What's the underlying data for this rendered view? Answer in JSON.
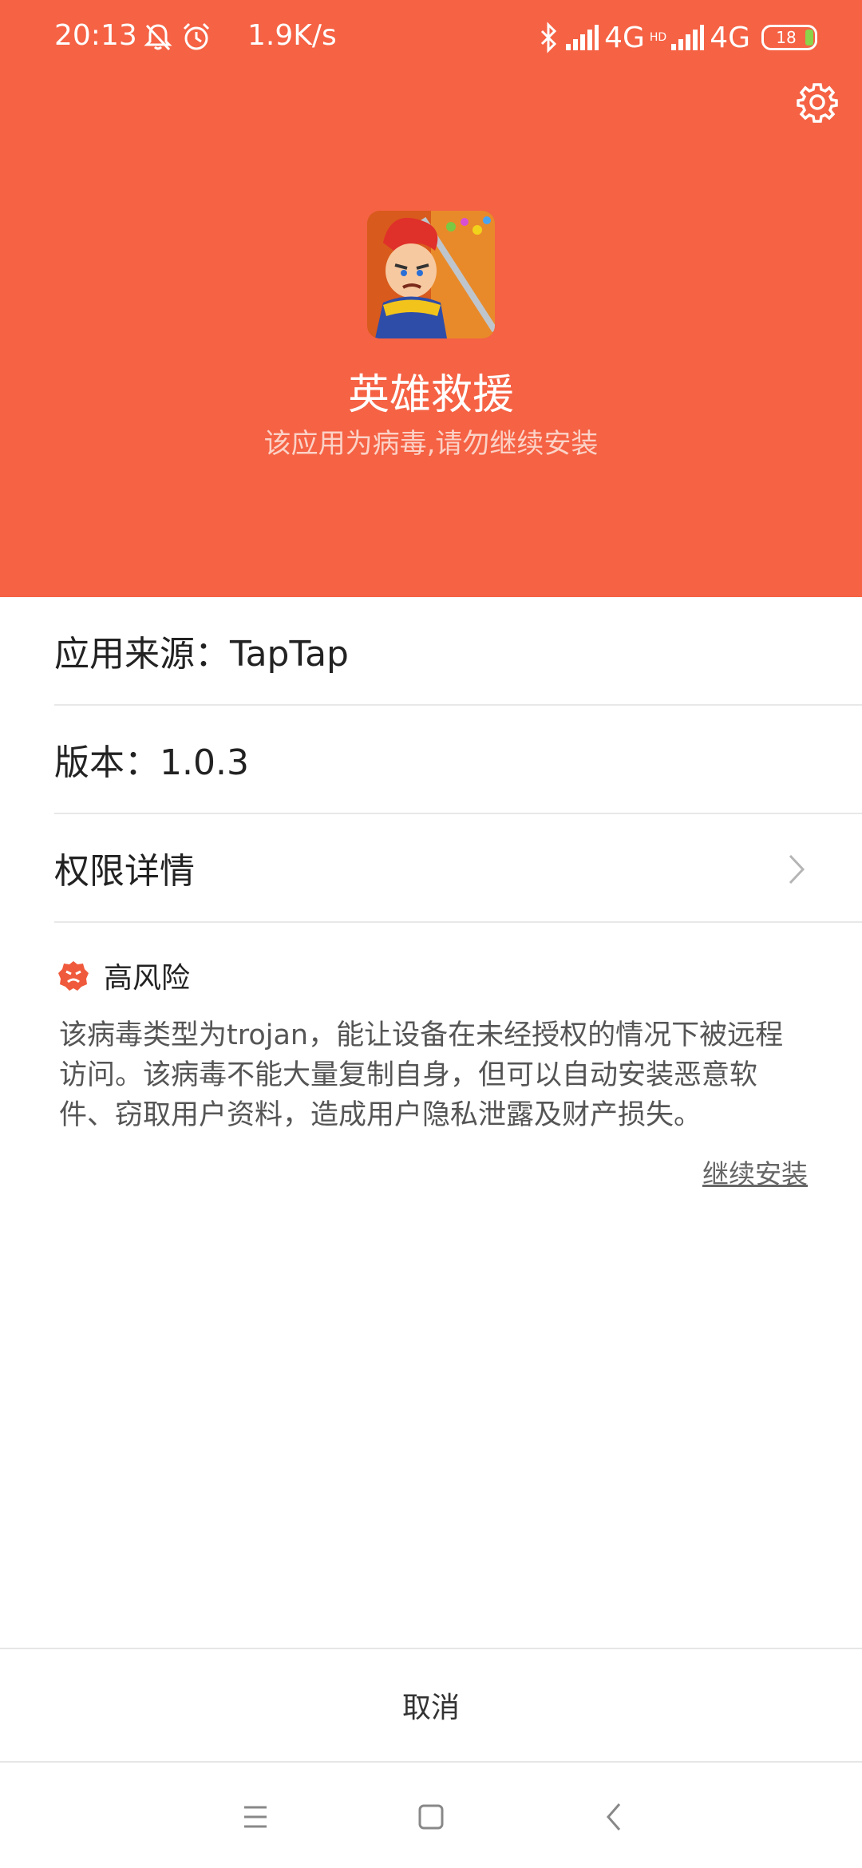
{
  "status_bar": {
    "time": "20:13",
    "speed": "1.9K/s",
    "network1": "4G",
    "hd_tag": "HD",
    "network2": "4G",
    "battery": "18"
  },
  "icons": {
    "mute": "bell-off-icon",
    "alarm": "alarm-icon",
    "bluetooth": "bluetooth-icon",
    "signal": "signal-icon",
    "settings": "gear-icon",
    "risk": "risk-face-icon",
    "chevron": "chevron-right-icon"
  },
  "app": {
    "name": "英雄救援",
    "warning": "该应用为病毒,请勿继续安装"
  },
  "info": {
    "source": "应用来源：TapTap",
    "version": "版本：1.0.3",
    "permissions": "权限详情"
  },
  "risk": {
    "level": "高风险",
    "description": "该病毒类型为trojan，能让设备在未经授权的情况下被远程访问。该病毒不能大量复制自身，但可以自动安装恶意软件、窃取用户资料，造成用户隐私泄露及财产损失。",
    "continue_label": "继续安装"
  },
  "footer": {
    "cancel_label": "取消"
  },
  "colors": {
    "header_bg": "#f56244",
    "risk_icon": "#f05a3c",
    "battery_fill": "#8bd34a"
  }
}
